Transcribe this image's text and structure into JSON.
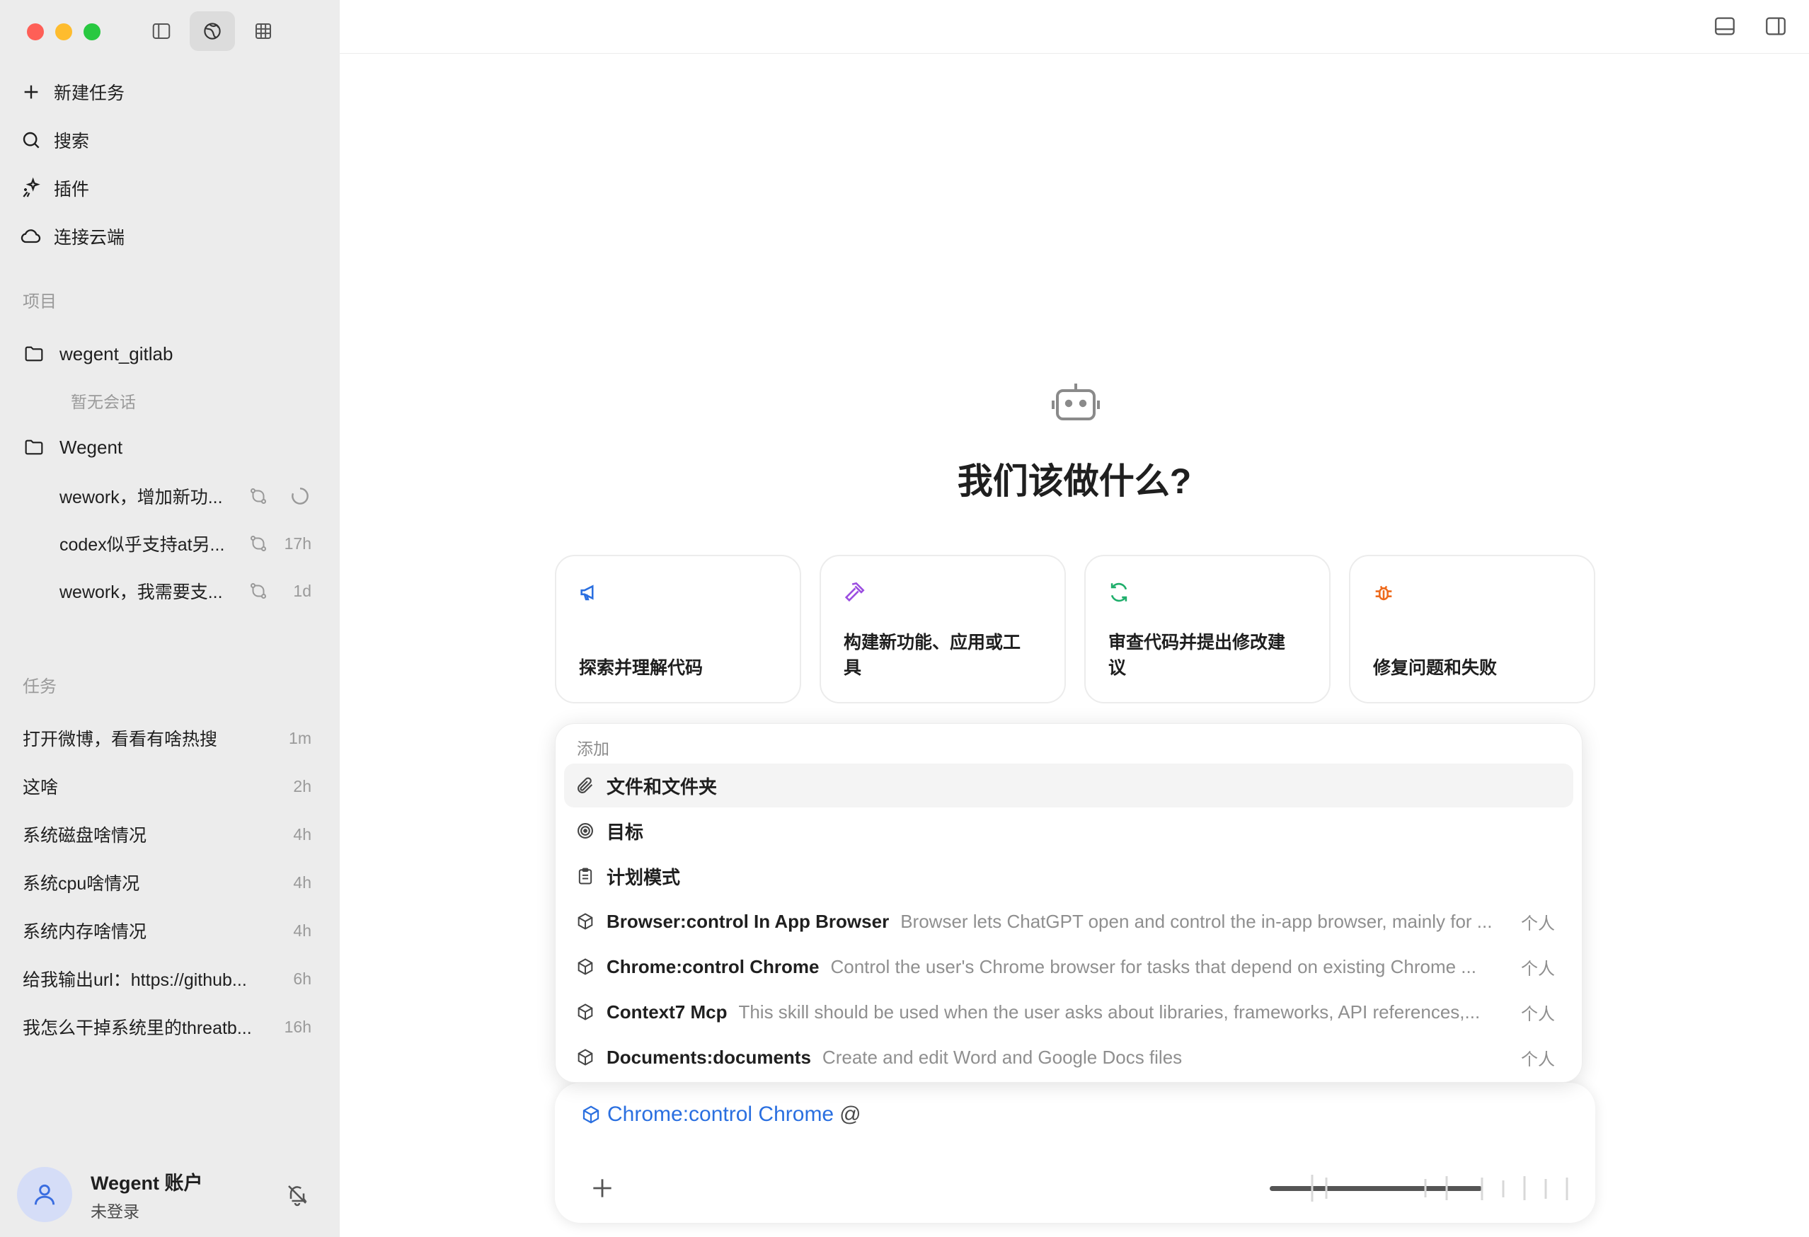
{
  "sidebar": {
    "nav": [
      {
        "label": "新建任务",
        "icon": "plus-icon"
      },
      {
        "label": "搜索",
        "icon": "search-icon"
      },
      {
        "label": "插件",
        "icon": "sparkle-plugin-icon"
      },
      {
        "label": "连接云端",
        "icon": "cloud-icon"
      }
    ],
    "projects_title": "项目",
    "projects": [
      {
        "name": "wegent_gitlab",
        "empty_text": "暂无会话"
      },
      {
        "name": "Wegent",
        "conversations": [
          {
            "title": "wework，增加新功...",
            "time": "",
            "loading": true
          },
          {
            "title": "codex似乎支持at另...",
            "time": "17h"
          },
          {
            "title": "wework，我需要支...",
            "time": "1d"
          }
        ]
      }
    ],
    "tasks_title": "任务",
    "tasks": [
      {
        "title": "打开微博，看看有啥热搜",
        "time": "1m"
      },
      {
        "title": "这啥",
        "time": "2h"
      },
      {
        "title": "系统磁盘啥情况",
        "time": "4h"
      },
      {
        "title": "系统cpu啥情况",
        "time": "4h"
      },
      {
        "title": "系统内存啥情况",
        "time": "4h"
      },
      {
        "title": "给我输出url：https://github...",
        "time": "6h"
      },
      {
        "title": "我怎么干掉系统里的threatb...",
        "time": "16h"
      }
    ],
    "account": {
      "name": "Wegent 账户",
      "status": "未登录"
    }
  },
  "main": {
    "headline": "我们该做什么?",
    "cards": [
      {
        "label": "探索并理解代码",
        "icon": "megaphone-icon",
        "color": "#2a6fe0"
      },
      {
        "label": "构建新功能、应用或工具",
        "icon": "hammer-icon",
        "color": "#9b4de0"
      },
      {
        "label": "审查代码并提出修改建议",
        "icon": "refresh-icon",
        "color": "#1fae6b"
      },
      {
        "label": "修复问题和失败",
        "icon": "bug-icon",
        "color": "#ee6a1c"
      }
    ],
    "dropdown": {
      "title": "添加",
      "items": [
        {
          "name": "文件和文件夹",
          "icon": "paperclip-icon",
          "desc": "",
          "tag": ""
        },
        {
          "name": "目标",
          "icon": "target-icon",
          "desc": "",
          "tag": ""
        },
        {
          "name": "计划模式",
          "icon": "clipboard-icon",
          "desc": "",
          "tag": ""
        },
        {
          "name": "Browser:control In App Browser",
          "icon": "cube-icon",
          "desc": "Browser lets ChatGPT open and control the in-app browser, mainly for ...",
          "tag": "个人"
        },
        {
          "name": "Chrome:control Chrome",
          "icon": "cube-icon",
          "desc": "Control the user's Chrome browser for tasks that depend on existing Chrome ...",
          "tag": "个人"
        },
        {
          "name": "Context7 Mcp",
          "icon": "cube-icon",
          "desc": "This skill should be used when the user asks about libraries, frameworks, API references,...",
          "tag": "个人"
        },
        {
          "name": "Documents:documents",
          "icon": "cube-icon",
          "desc": "Create and edit Word and Google Docs files",
          "tag": "个人"
        }
      ]
    },
    "composer": {
      "chip": "Chrome:control Chrome",
      "trailing": "@"
    }
  },
  "colors": {
    "sidebar_bg": "#ececec",
    "accent": "#2a6fe0"
  }
}
